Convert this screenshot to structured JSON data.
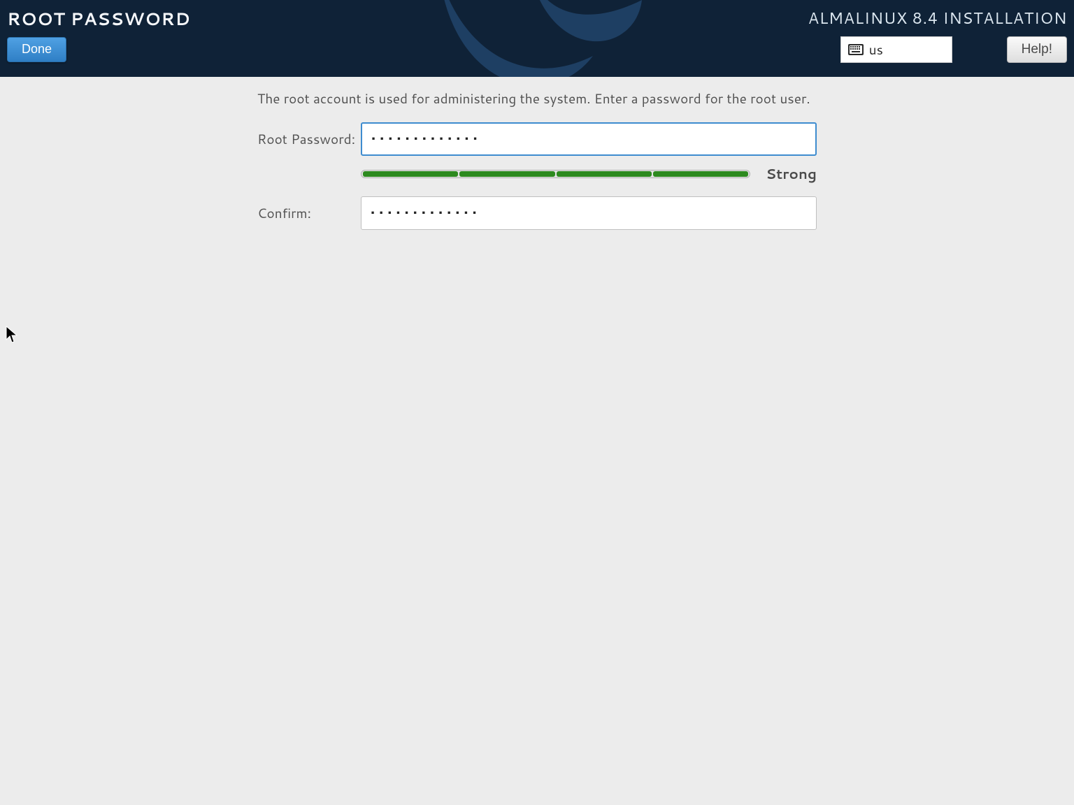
{
  "header": {
    "page_title": "ROOT PASSWORD",
    "done_label": "Done",
    "installer_title": "ALMALINUX 8.4 INSTALLATION",
    "kb_layout": "us",
    "help_label": "Help!"
  },
  "form": {
    "description": "The root account is used for administering the system.  Enter a password for the root user.",
    "password_label": "Root Password:",
    "password_value": "•••••••••••••",
    "confirm_label": "Confirm:",
    "confirm_value": "•••••••••••••",
    "strength_label": "Strong",
    "strength_segments": 4,
    "strength_color": "#2d8a1f"
  }
}
